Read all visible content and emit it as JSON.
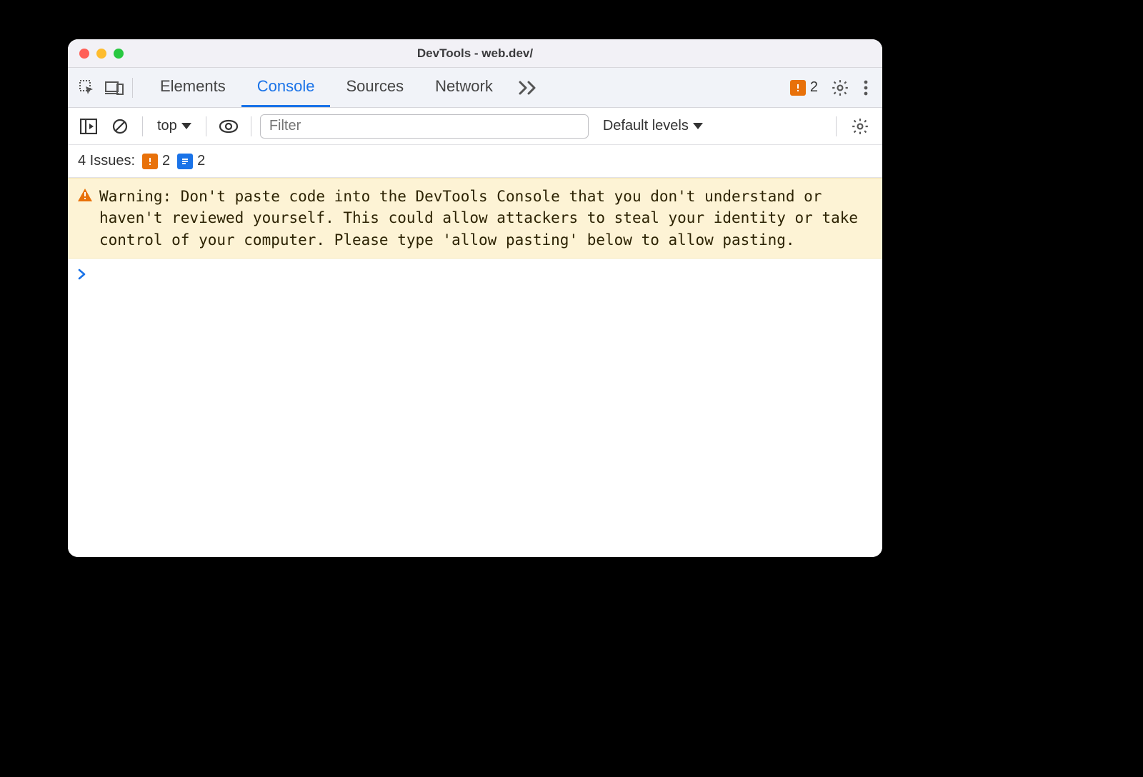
{
  "window": {
    "title": "DevTools - web.dev/"
  },
  "tabs": {
    "items": [
      "Elements",
      "Console",
      "Sources",
      "Network"
    ],
    "active_index": 1,
    "error_badge_count": "2"
  },
  "toolbar": {
    "context_label": "top",
    "filter_placeholder": "Filter",
    "levels_label": "Default levels"
  },
  "issues": {
    "label": "4 Issues:",
    "orange_count": "2",
    "blue_count": "2"
  },
  "console": {
    "warning_text": "Warning: Don't paste code into the DevTools Console that you don't understand or haven't reviewed yourself. This could allow attackers to steal your identity or take control of your computer. Please type 'allow pasting' below to allow pasting.",
    "prompt_symbol": ">"
  }
}
